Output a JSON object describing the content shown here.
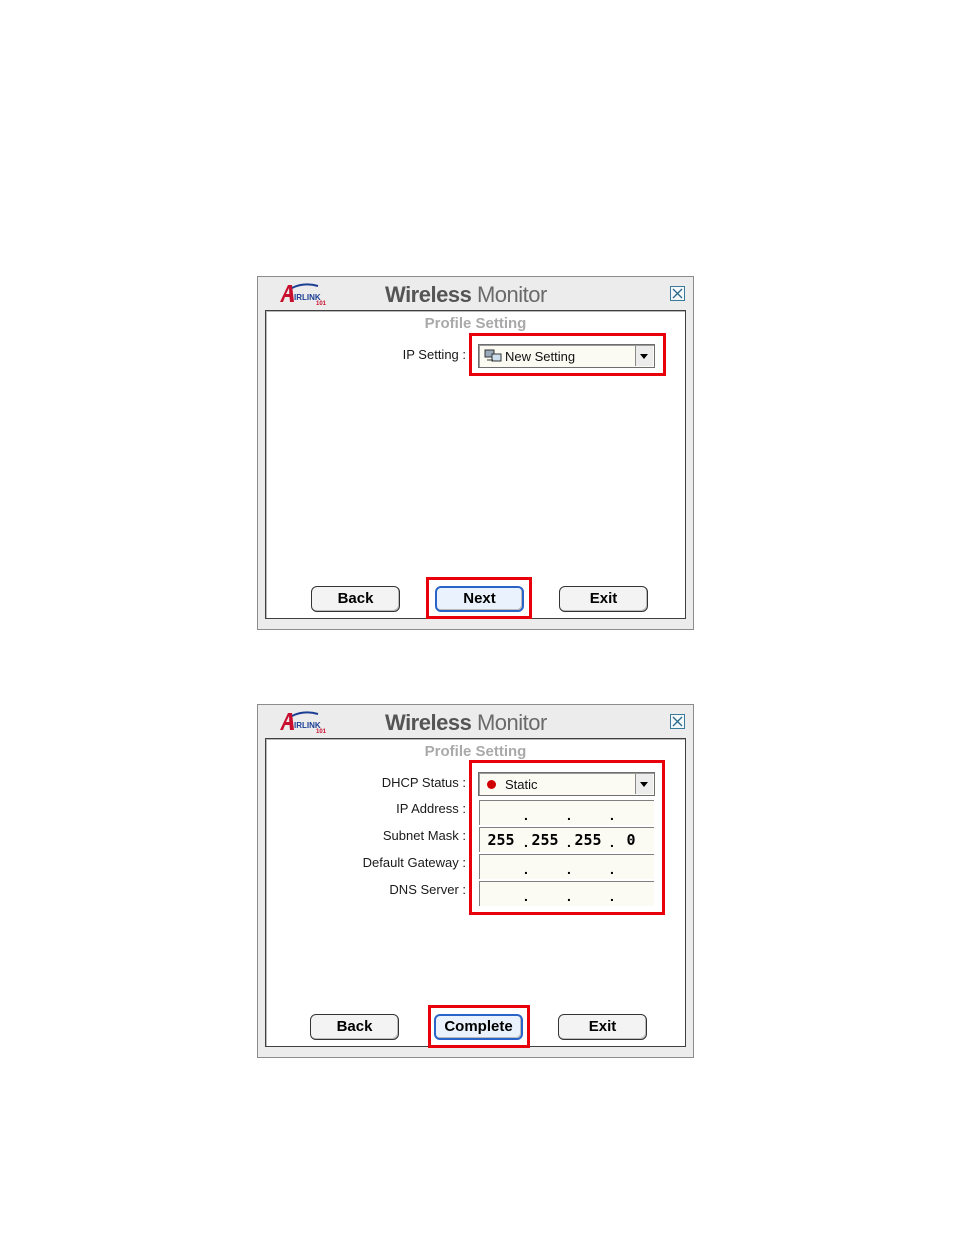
{
  "windows": [
    {
      "app_title_bold": "Wireless",
      "app_title_light": "Monitor",
      "panel_title": "Profile Setting",
      "fields": [
        {
          "label": "IP Setting :",
          "value": "New Setting",
          "type": "combo"
        }
      ],
      "buttons": {
        "back": "Back",
        "next": "Next",
        "exit": "Exit"
      }
    },
    {
      "app_title_bold": "Wireless",
      "app_title_light": "Monitor",
      "panel_title": "Profile Setting",
      "dhcp": {
        "label": "DHCP Status :",
        "value": "Static"
      },
      "ip_fields": [
        {
          "label": "IP Address :",
          "octets": [
            "",
            "",
            "",
            ""
          ]
        },
        {
          "label": "Subnet Mask :",
          "octets": [
            "255",
            "255",
            "255",
            "0"
          ]
        },
        {
          "label": "Default Gateway :",
          "octets": [
            "",
            "",
            "",
            ""
          ]
        },
        {
          "label": "DNS Server :",
          "octets": [
            "",
            "",
            "",
            ""
          ]
        }
      ],
      "buttons": {
        "back": "Back",
        "complete": "Complete",
        "exit": "Exit"
      }
    }
  ],
  "colors": {
    "highlight": "#e8000a",
    "status_static": "#d00000",
    "focus_border": "#2b64c8"
  },
  "icons": [
    "airlink-logo",
    "close-icon",
    "network-icon",
    "dropdown-arrow-icon",
    "status-dot-icon"
  ]
}
